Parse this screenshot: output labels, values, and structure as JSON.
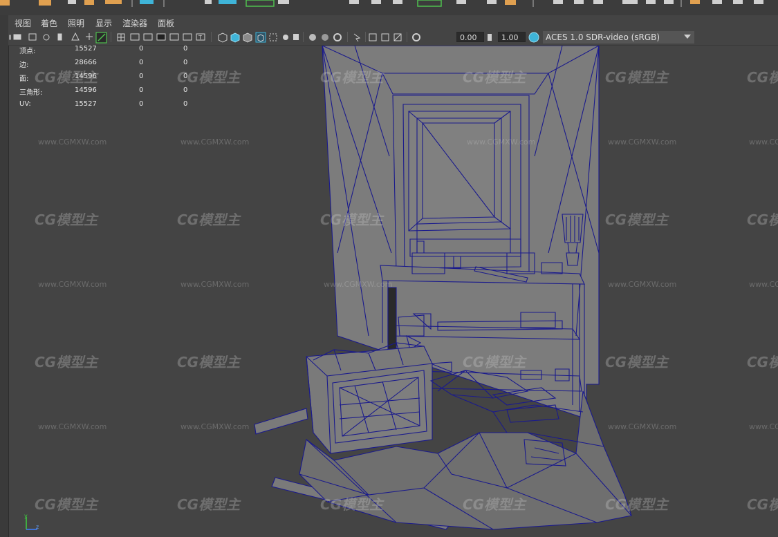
{
  "menu": {
    "items": [
      "视图",
      "着色",
      "照明",
      "显示",
      "渲染器",
      "面板"
    ]
  },
  "toolbar": {
    "field_a": "0.00",
    "field_b": "1.00",
    "color_space": "ACES 1.0 SDR-video (sRGB)"
  },
  "hud": {
    "rows": [
      {
        "label": "顶点:",
        "v1": "15527",
        "v2": "0",
        "v3": "0"
      },
      {
        "label": "边:",
        "v1": "28666",
        "v2": "0",
        "v3": "0"
      },
      {
        "label": "面:",
        "v1": "14596",
        "v2": "0",
        "v3": "0"
      },
      {
        "label": "三角形:",
        "v1": "14596",
        "v2": "0",
        "v3": "0"
      },
      {
        "label": "UV:",
        "v1": "15527",
        "v2": "0",
        "v3": "0"
      }
    ]
  },
  "watermark": {
    "logo": "CG模型主",
    "url": "www.CGMXW.com"
  },
  "axis": {
    "y": "y",
    "z": "z"
  },
  "colors": {
    "wireframe": "#1a1a8c",
    "surface": "#7a7a7a",
    "viewport_bg": "#444444",
    "accent_orange": "#e0a050",
    "accent_green": "#4fc04f",
    "accent_cyan": "#3fb4d8"
  }
}
